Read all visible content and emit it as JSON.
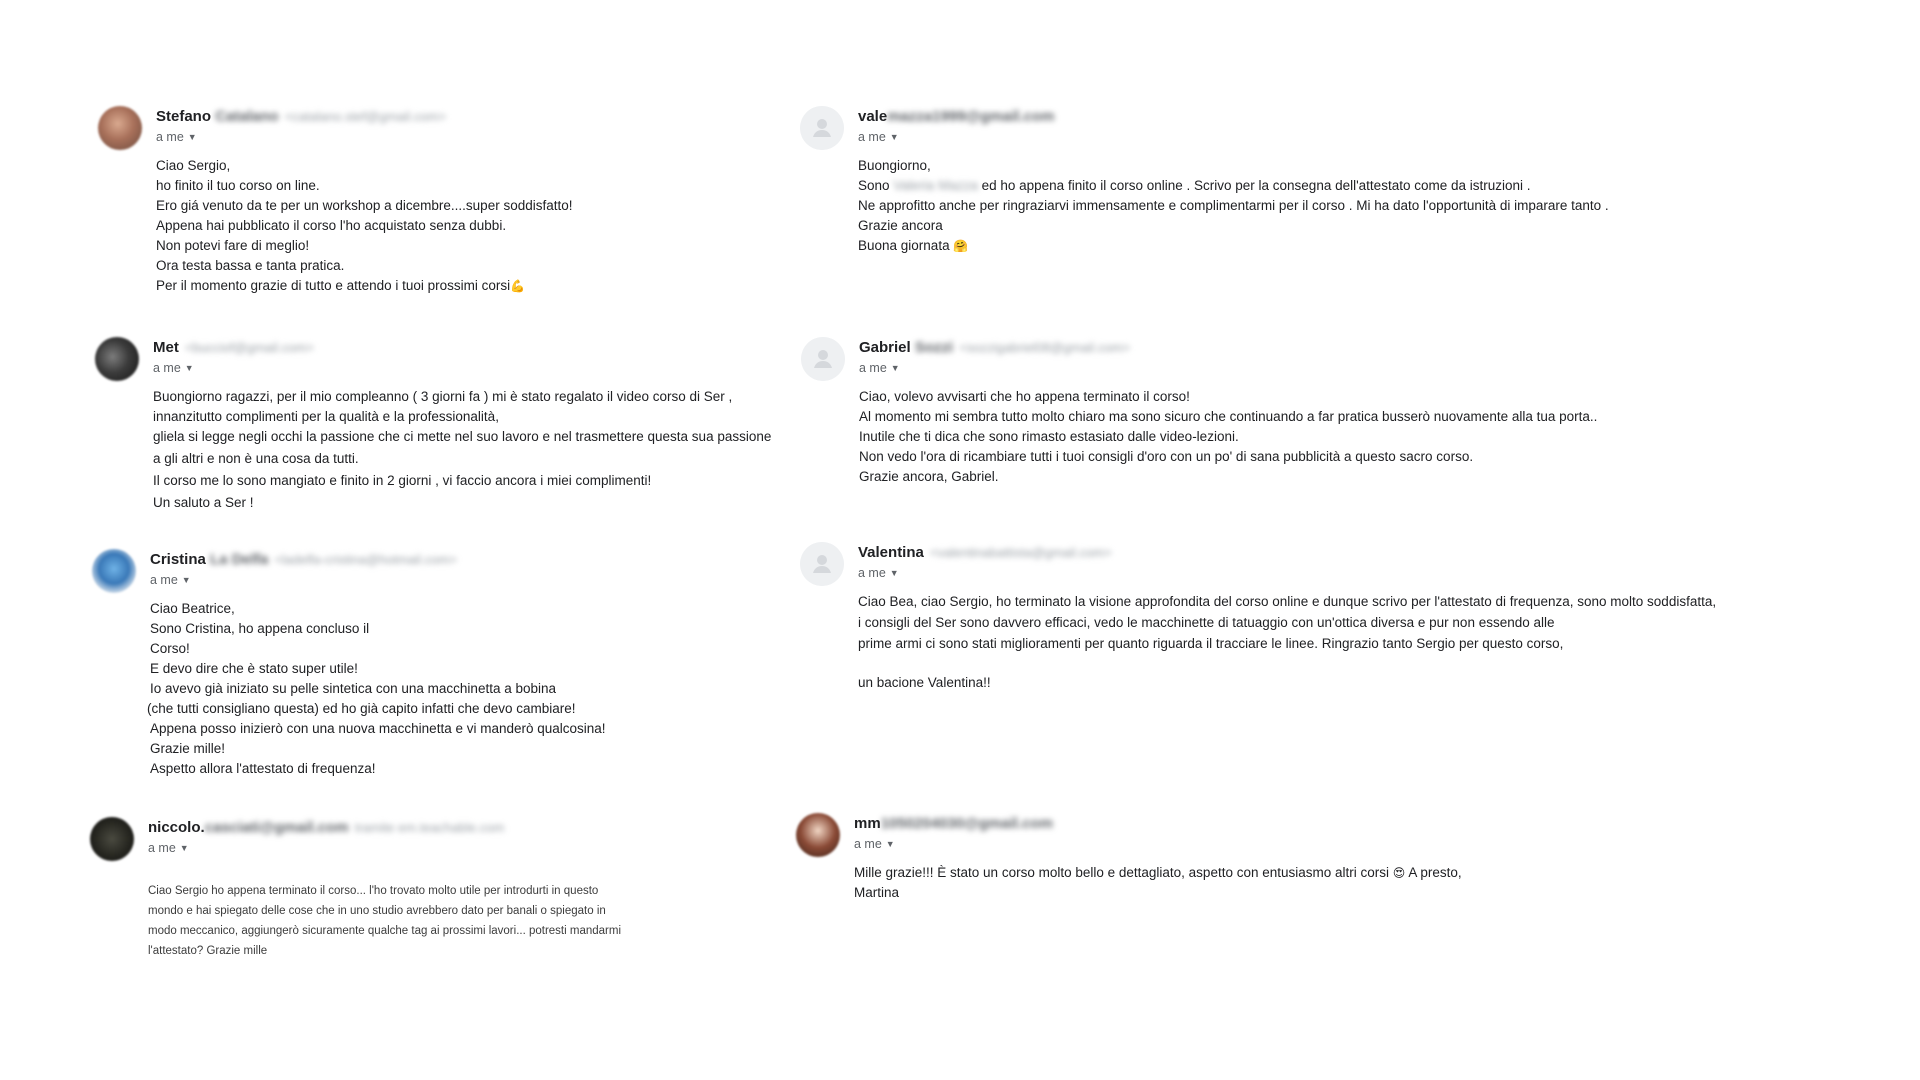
{
  "emails": [
    {
      "id": "stefano",
      "sender_name": "Stefano",
      "sender_blur": "Catalano",
      "sender_email": "<catalano.stef@gmail.com>",
      "recipient": "a me",
      "body": [
        "Ciao Sergio,",
        "ho finito il tuo corso on line.",
        "Ero giá venuto da te per un workshop a dicembre....super soddisfatto!",
        "Appena hai pubblicato il corso l'ho acquistato senza dubbi.",
        "Non potevi fare di meglio!",
        "Ora testa bassa e tanta pratica.",
        "Per il momento grazie di tutto e attendo i tuoi prossimi corsi"
      ],
      "body_emoji": "💪"
    },
    {
      "id": "met",
      "sender_name": "Met",
      "sender_blur": "",
      "sender_email": "<bucciof@gmail.com>",
      "recipient": "a me",
      "body": [
        "Buongiorno ragazzi, per il mio compleanno ( 3 giorni fa ) mi è stato regalato il video corso di Ser ,",
        "innanzitutto complimenti per la qualità e la professionalità,",
        "gliela si legge negli occhi la passione che ci mette nel suo lavoro e nel trasmettere questa sua passione",
        "a gli altri e non è una cosa da tutti.",
        "Il corso me lo sono mangiato e finito in 2 giorni , vi faccio ancora i miei complimenti!",
        "Un saluto a Ser !"
      ]
    },
    {
      "id": "cristina",
      "sender_name": "Cristina",
      "sender_blur": "La Delfa",
      "sender_email": "<ladelfa-cristina@hotmail.com>",
      "recipient": "a me",
      "body": [
        "Ciao Beatrice,",
        "Sono Cristina, ho appena concluso il",
        "Corso!",
        "E devo dire che è stato super utile!",
        "Io avevo già iniziato su pelle sintetica con una macchinetta a bobina",
        "(che tutti consigliano questa) ed ho già capito infatti che devo cambiare!",
        "Appena posso inizierò con una nuova macchinetta e vi manderò qualcosina!",
        "Grazie mille!",
        "Aspetto allora l'attestato di frequenza!"
      ]
    },
    {
      "id": "niccolo",
      "sender_name": "niccolo.",
      "sender_blur": "casciati@gmail.com",
      "sender_email": "tramite em.teachable.com",
      "recipient": "a me",
      "body": [
        "Ciao Sergio ho appena terminato il corso... l'ho trovato molto utile per introdurti in questo",
        "mondo e hai spiegato delle cose che in uno studio avrebbero dato per banali o spiegato in",
        "modo meccanico, aggiungerò sicuramente qualche tag ai prossimi lavori... potresti mandarmi",
        "l'attestato? Grazie mille"
      ]
    },
    {
      "id": "vale",
      "sender_name": "vale",
      "sender_blur": "mazza1999@gmail.com",
      "sender_email": "",
      "recipient": "a me",
      "body_intro": "Buongiorno,",
      "body_sono": "Sono",
      "body_sono_blur": "Valeria Mazza",
      "body_sono_rest": "ed ho appena finito il corso online . Scrivo per la consegna dell'attestato come da istruzioni .",
      "body": [
        "Ne approfitto anche per ringraziarvi immensamente e complimentarmi per il corso . Mi ha dato l'opportunità di imparare tanto .",
        "Grazie ancora",
        "Buona giornata"
      ],
      "body_emoji": "🤗"
    },
    {
      "id": "gabriel",
      "sender_name": "Gabriel",
      "sender_blur": "Sozzi",
      "sender_email": "<sozzigabriel08@gmail.com>",
      "recipient": "a me",
      "body": [
        "Ciao, volevo avvisarti che ho appena terminato il corso!",
        "Al momento mi sembra tutto molto chiaro ma sono sicuro che continuando a far pratica busserò nuovamente alla tua porta..",
        "Inutile che ti dica che sono rimasto estasiato dalle video-lezioni.",
        "Non vedo l'ora di ricambiare tutti i tuoi consigli d'oro con un po' di sana pubblicità a questo sacro corso.",
        "Grazie ancora, Gabriel."
      ]
    },
    {
      "id": "valentina",
      "sender_name": "Valentina",
      "sender_blur": "",
      "sender_email": "<valentinabattista@gmail.com>",
      "recipient": "a me",
      "body": [
        "Ciao Bea, ciao Sergio, ho terminato la visione approfondita del corso online e dunque scrivo per l'attestato di frequenza, sono molto soddisfatta,",
        "i consigli del Ser sono davvero efficaci, vedo le macchinette di tatuaggio con un'ottica diversa e pur non essendo alle",
        "prime armi ci sono stati miglioramenti per quanto riguarda il tracciare le linee. Ringrazio tanto Sergio per questo corso,"
      ],
      "signoff": "un bacione Valentina!!"
    },
    {
      "id": "mm",
      "sender_name": "mm",
      "sender_blur": "1050204030@gmail.com",
      "sender_email": "",
      "recipient": "a me",
      "body_main": "Mille grazie!!! È stato un corso molto bello e dettagliato, aspetto con entusiasmo altri corsi",
      "body_emoji": "😍",
      "body_tail": "A presto,",
      "body": [
        "Martina"
      ]
    }
  ]
}
